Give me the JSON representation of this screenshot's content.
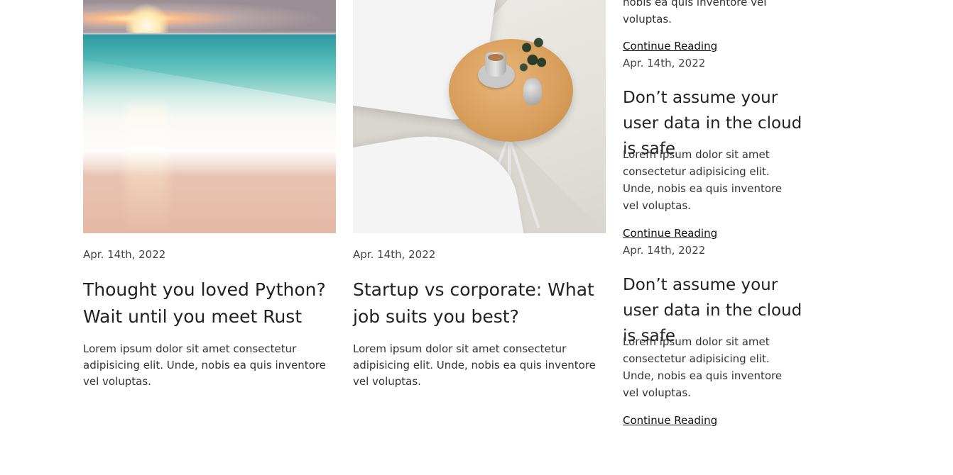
{
  "cards": [
    {
      "image_alt": "beach",
      "date": "Apr. 14th, 2022",
      "title": "Thought you loved Python? Wait until you meet Rust",
      "excerpt": "Lorem ipsum dolor sit amet consectetur adipisicing elit. Unde, nobis ea quis inventore vel voluptas."
    },
    {
      "image_alt": "table",
      "date": "Apr. 14th, 2022",
      "title": "Startup vs corporate: What job suits you best?",
      "excerpt": "Lorem ipsum dolor sit amet consectetur adipisicing elit. Unde, nobis ea quis inventore vel voluptas."
    }
  ],
  "sidebar": {
    "top_excerpt_tail": "nobis ea quis inventore vel voluptas.",
    "top_link": "Continue Reading",
    "posts": [
      {
        "date": "Apr. 14th, 2022",
        "title": "Don’t assume your user data in the cloud is safe",
        "excerpt": "Lorem ipsum dolor sit amet consectetur adipisicing elit. Unde, nobis ea quis inventore vel voluptas.",
        "link": "Continue Reading"
      },
      {
        "date": "Apr. 14th, 2022",
        "title": "Don’t assume your user data in the cloud is safe",
        "excerpt": "Lorem ipsum dolor sit amet consectetur adipisicing elit. Unde, nobis ea quis inventore vel voluptas.",
        "link": "Continue Reading"
      }
    ]
  }
}
